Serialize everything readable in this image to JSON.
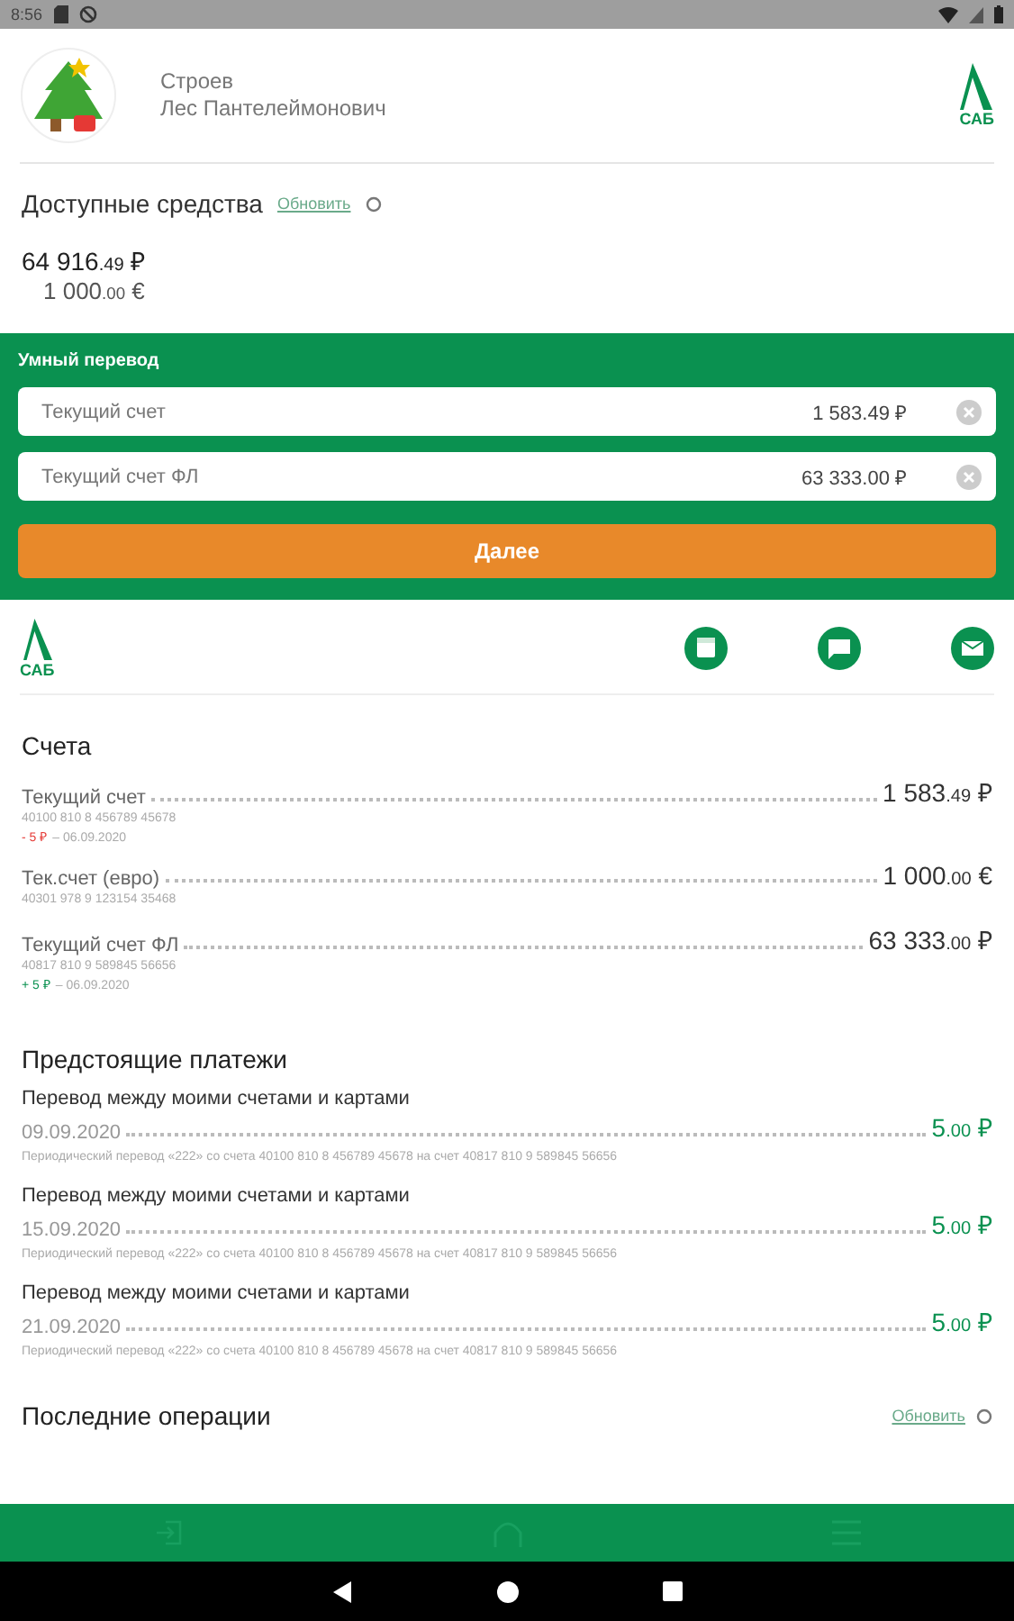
{
  "status_bar": {
    "time": "8:56"
  },
  "profile": {
    "surname": "Строев",
    "name": "Лес Пантелеймонович",
    "logo": "САБ"
  },
  "funds": {
    "title": "Доступные средства",
    "refresh": "Обновить",
    "balances": [
      {
        "amount": "64 916",
        "cents": ".49",
        "currency": "₽",
        "kind": "main"
      },
      {
        "amount": "1 000",
        "cents": ".00",
        "currency": "€",
        "kind": "secondary"
      }
    ]
  },
  "smart_transfer": {
    "title": "Умный перевод",
    "fields": [
      {
        "value": "Текущий счет",
        "amount": "1 583.49 ₽"
      },
      {
        "value": "Текущий счет ФЛ",
        "amount": "63 333.00 ₽"
      }
    ],
    "button": "Далее"
  },
  "toolbar": {
    "logo": "САБ"
  },
  "accounts": {
    "title": "Счета",
    "items": [
      {
        "name": "Текущий счет",
        "number": "40100 810 8 456789 45678",
        "amount": "1 583",
        "cents": ".49",
        "currency": "₽",
        "change": "- 5 ₽",
        "kind": "debit",
        "date": "– 06.09.2020"
      },
      {
        "name": "Тек.счет (евро)",
        "number": "40301 978 9 123154 35468",
        "amount": "1 000",
        "cents": ".00",
        "currency": "€"
      },
      {
        "name": "Текущий счет ФЛ",
        "number": "40817 810 9 589845 56656",
        "amount": "63 333",
        "cents": ".00",
        "currency": "₽",
        "change": "+ 5 ₽",
        "kind": "credit",
        "date": "– 06.09.2020"
      }
    ]
  },
  "upcoming": {
    "title": "Предстоящие платежи",
    "items": [
      {
        "title": "Перевод между моими счетами и картами",
        "date": "09.09.2020",
        "amount": "5",
        "cents": ".00",
        "currency": "₽",
        "note": "Периодический перевод «222» со счета 40100 810 8 456789 45678 на счет 40817 810 9 589845 56656"
      },
      {
        "title": "Перевод между моими счетами и картами",
        "date": "15.09.2020",
        "amount": "5",
        "cents": ".00",
        "currency": "₽",
        "note": "Периодический перевод «222» со счета 40100 810 8 456789 45678 на счет 40817 810 9 589845 56656"
      },
      {
        "title": "Перевод между моими счетами и картами",
        "date": "21.09.2020",
        "amount": "5",
        "cents": ".00",
        "currency": "₽",
        "note": "Периодический перевод «222» со счета 40100 810 8 456789 45678 на счет 40817 810 9 589845 56656"
      }
    ]
  },
  "recent": {
    "title": "Последние операции",
    "refresh": "Обновить"
  }
}
